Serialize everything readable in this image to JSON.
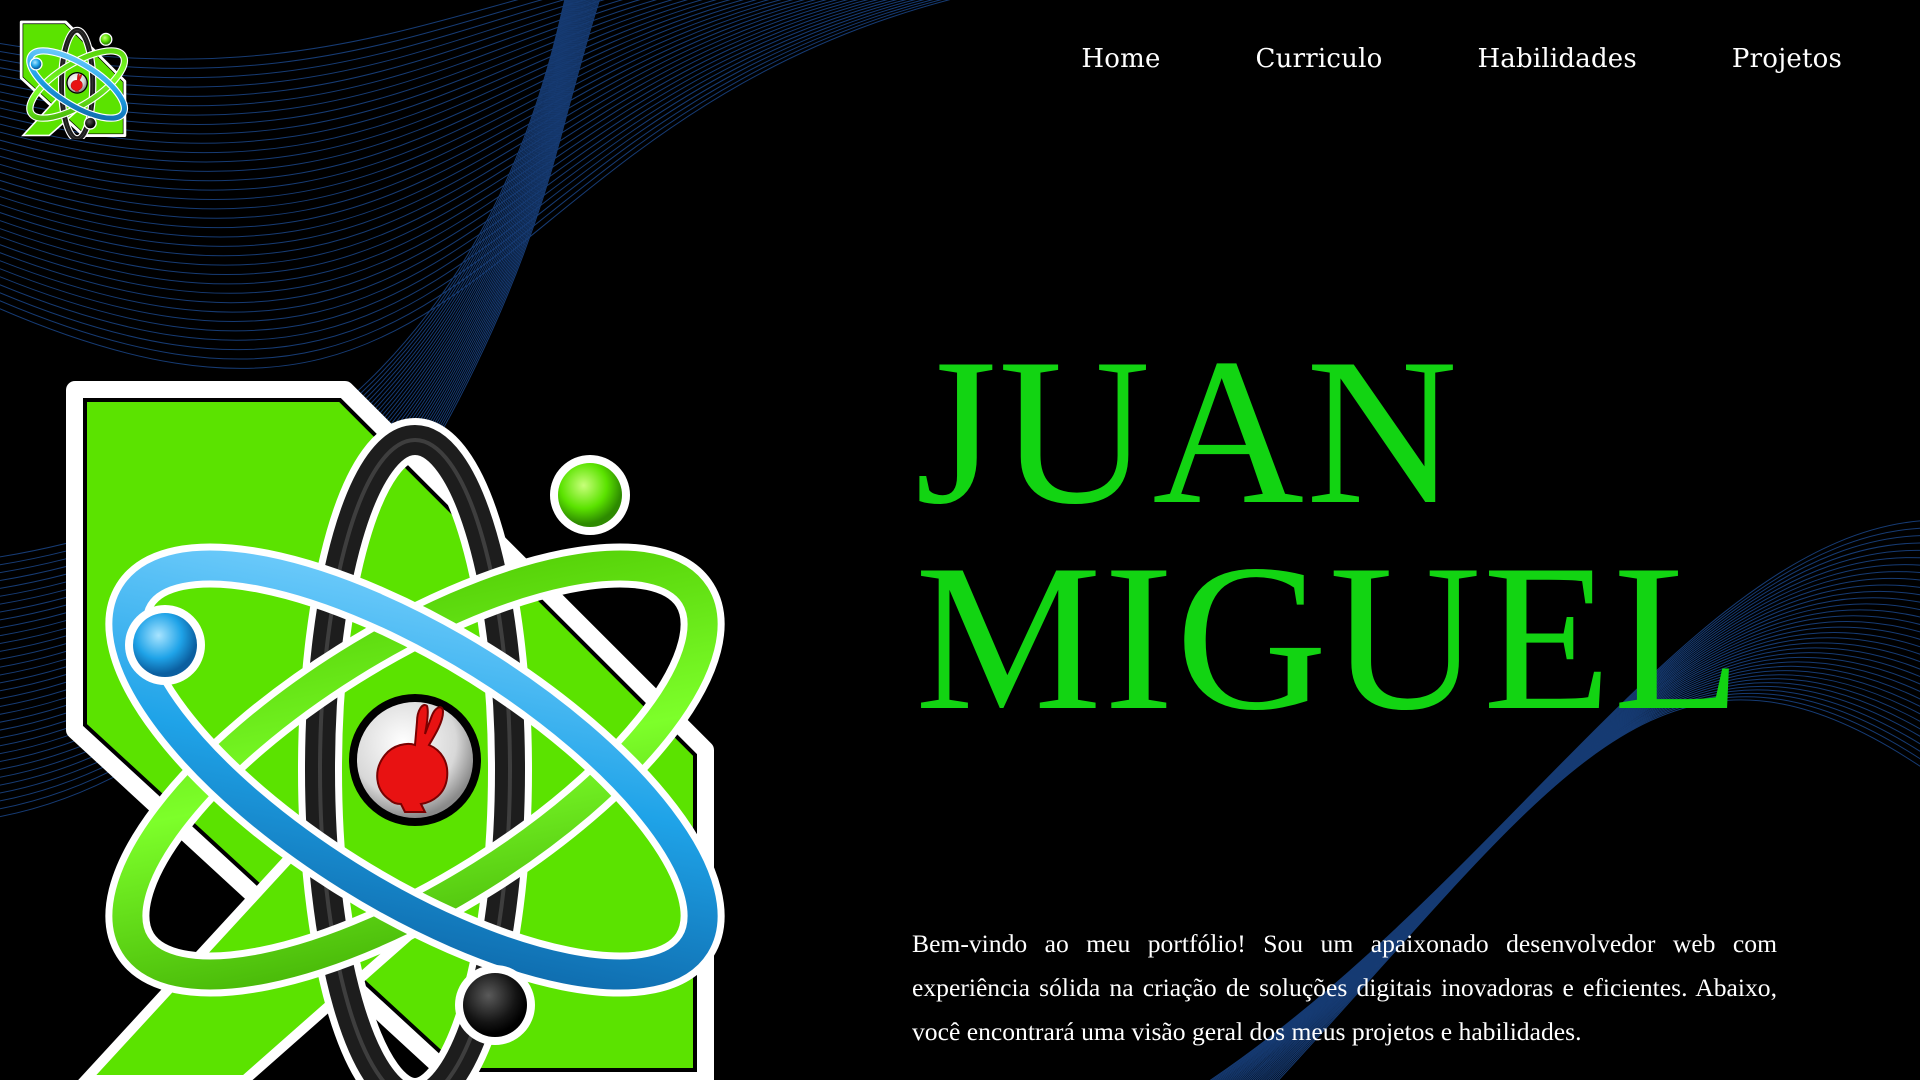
{
  "nav": {
    "items": [
      {
        "label": "Home"
      },
      {
        "label": "Curriculo"
      },
      {
        "label": "Habilidades"
      },
      {
        "label": "Projetos"
      }
    ]
  },
  "hero": {
    "name_line1": "JUAN",
    "name_line2": "MIGUEL",
    "intro": "Bem-vindo ao meu portfólio! Sou um apaixonado desenvolvedor web com experiência sólida na criação de soluções digitais inovadoras e eficientes. Abaixo, você encontrará uma visão geral dos meus projetos e habilidades."
  },
  "colors": {
    "background": "#000000",
    "accent_green": "#12d412",
    "logo_green": "#5be300",
    "logo_blue": "#1fa3e8",
    "logo_red": "#e81212",
    "wave_blue": "#1e4f9a"
  },
  "icons": {
    "logo": "atom-x-rabbit-logo"
  }
}
